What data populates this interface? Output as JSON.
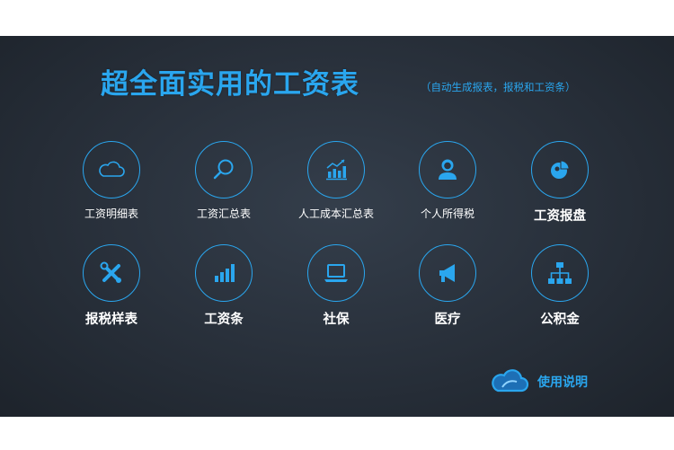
{
  "header": {
    "title": "超全面实用的工资表",
    "subtitle": "（自动生成报表，报税和工资条）"
  },
  "accent_color": "#2aa6ee",
  "row1": [
    {
      "label": "工资明细表",
      "icon": "cloud-icon"
    },
    {
      "label": "工资汇总表",
      "icon": "search-icon"
    },
    {
      "label": "人工成本汇总表",
      "icon": "bar-chart-growth-icon"
    },
    {
      "label": "个人所得税",
      "icon": "person-icon"
    },
    {
      "label": "工资报盘",
      "icon": "pie-chart-icon"
    }
  ],
  "row2": [
    {
      "label": "报税样表",
      "icon": "tools-icon"
    },
    {
      "label": "工资条",
      "icon": "bar-chart-icon"
    },
    {
      "label": "社保",
      "icon": "laptop-icon"
    },
    {
      "label": "医疗",
      "icon": "megaphone-icon"
    },
    {
      "label": "公积金",
      "icon": "org-chart-icon"
    }
  ],
  "help": {
    "label": "使用说明",
    "icon": "cloud-logo-icon"
  }
}
